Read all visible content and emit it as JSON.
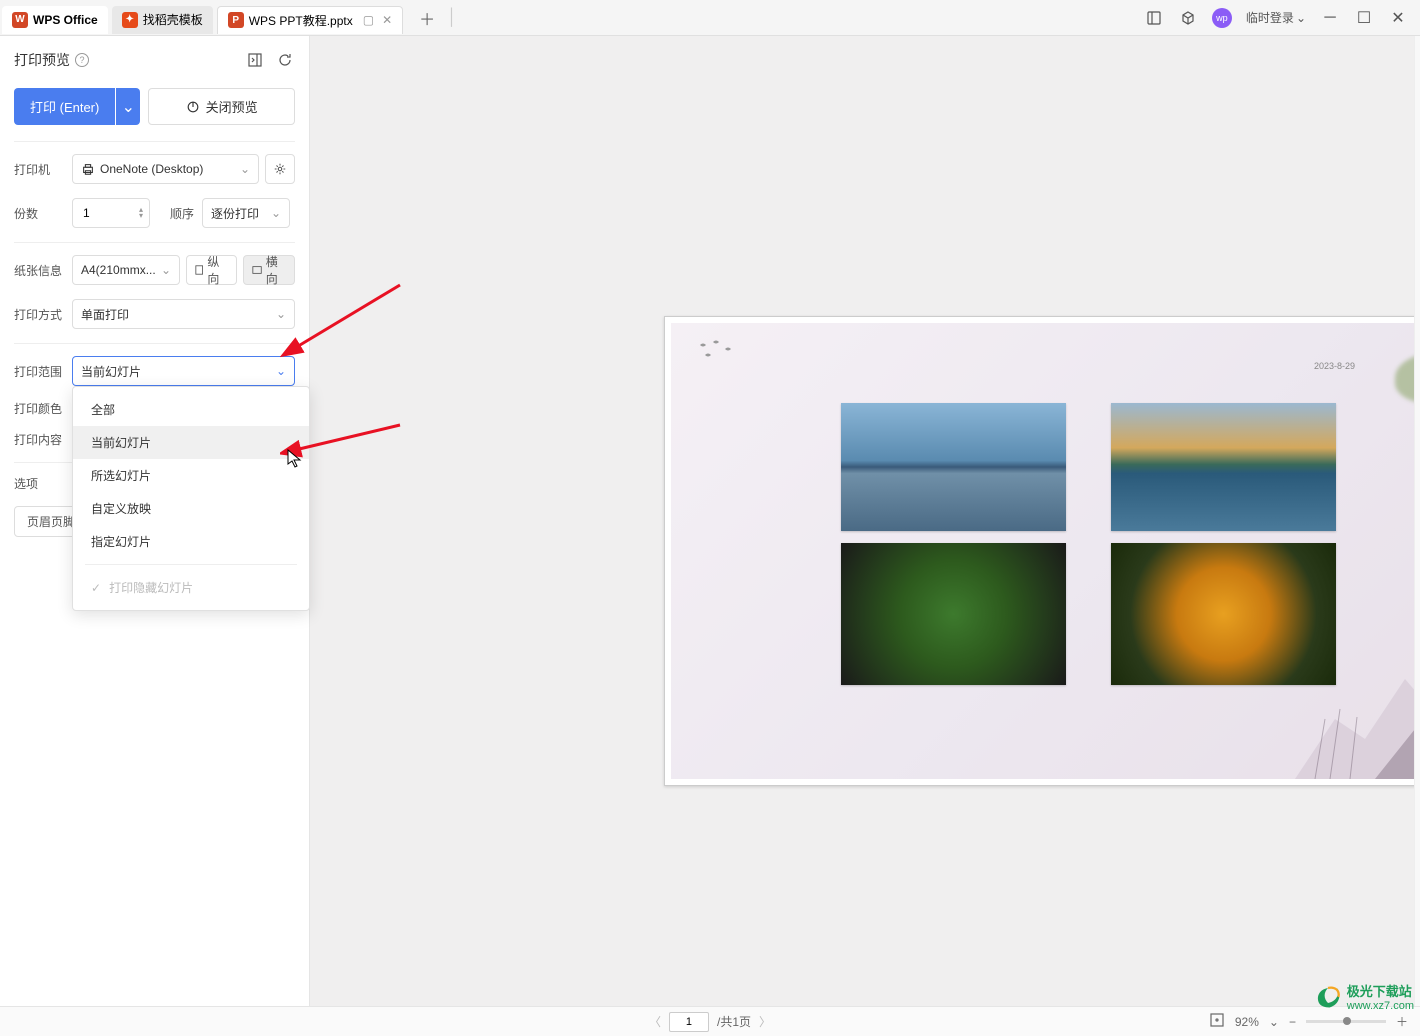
{
  "titlebar": {
    "app_name": "WPS Office",
    "template_tab": "找稻壳模板",
    "file_tab": "WPS PPT教程.pptx",
    "login_text": "临时登录"
  },
  "sidebar": {
    "title": "打印预览",
    "print_btn": "打印 (Enter)",
    "close_btn": "关闭预览",
    "printer_label": "打印机",
    "printer_value": "OneNote (Desktop)",
    "copies_label": "份数",
    "copies_value": "1",
    "order_label": "顺序",
    "order_value": "逐份打印",
    "paper_label": "纸张信息",
    "paper_value": "A4(210mmx...",
    "orient_portrait": "纵向",
    "orient_landscape": "横向",
    "mode_label": "打印方式",
    "mode_value": "单面打印",
    "range_label": "打印范围",
    "range_value": "当前幻灯片",
    "color_label": "打印颜色",
    "content_label": "打印内容",
    "options_label": "选项",
    "header_footer_btn": "页眉页脚"
  },
  "dropdown": {
    "items": [
      "全部",
      "当前幻灯片",
      "所选幻灯片",
      "自定义放映",
      "指定幻灯片"
    ],
    "hidden_item": "打印隐藏幻灯片"
  },
  "slide": {
    "date": "2023-8-29"
  },
  "statusbar": {
    "page_value": "1",
    "page_total": "/共1页",
    "zoom": "92%"
  },
  "watermark": {
    "text": "极光下载站",
    "url": "www.xz7.com"
  }
}
